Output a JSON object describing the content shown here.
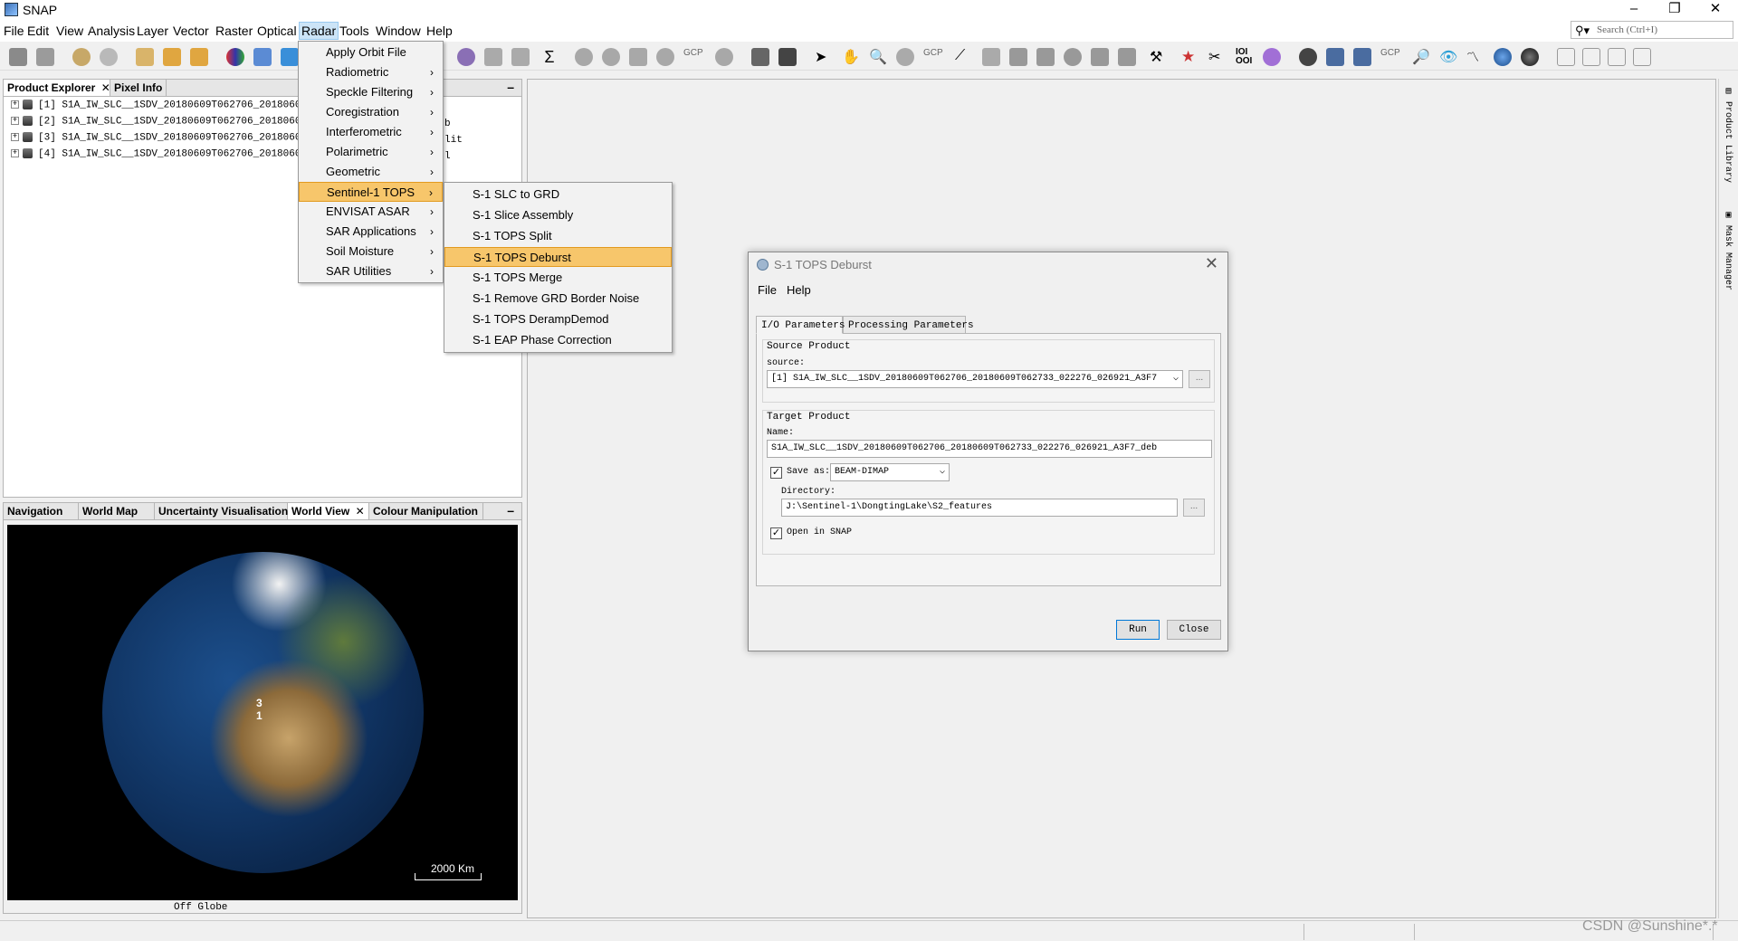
{
  "window": {
    "title": "SNAP",
    "controls": [
      "–",
      "❐",
      "✕"
    ]
  },
  "menubar": {
    "items": [
      "File",
      "Edit",
      "View",
      "Analysis",
      "Layer",
      "Vector",
      "Raster",
      "Optical",
      "Radar",
      "Tools",
      "Window",
      "Help"
    ],
    "search_placeholder": "Search (Ctrl+I)"
  },
  "toolbar": {
    "gcp_label": "GCP",
    "icon_names": [
      "open-product-icon",
      "save-product-icon",
      "undo-icon",
      "redo-icon",
      "import-icon",
      "export-icon",
      "band-maths-icon",
      "rgb-image-icon",
      "pin-icon",
      "polygon-icon",
      "graph-builder-icon",
      "batch-icon",
      "histogram-icon",
      "scatter-plot-icon",
      "statistics-icon",
      "mask-icon",
      "grid-icon",
      "gcp-icon",
      "select-icon",
      "pan-icon",
      "zoom-icon",
      "measure-icon",
      "world-map-icon",
      "3d-globe-icon",
      "layout-icons"
    ]
  },
  "radar_menu": {
    "items": [
      {
        "label": "Apply Orbit File",
        "submenu": false
      },
      {
        "label": "Radiometric",
        "submenu": true
      },
      {
        "label": "Speckle Filtering",
        "submenu": true
      },
      {
        "label": "Coregistration",
        "submenu": true
      },
      {
        "label": "Interferometric",
        "submenu": true
      },
      {
        "label": "Polarimetric",
        "submenu": true
      },
      {
        "label": "Geometric",
        "submenu": true
      },
      {
        "label": "Sentinel-1 TOPS",
        "submenu": true,
        "selected": true
      },
      {
        "label": "ENVISAT ASAR",
        "submenu": true
      },
      {
        "label": "SAR Applications",
        "submenu": true
      },
      {
        "label": "Soil Moisture",
        "submenu": true
      },
      {
        "label": "SAR Utilities",
        "submenu": true
      }
    ],
    "arrow": "›"
  },
  "tops_submenu": {
    "items": [
      {
        "label": "S-1 SLC to GRD"
      },
      {
        "label": "S-1 Slice Assembly"
      },
      {
        "label": "S-1 TOPS Split"
      },
      {
        "label": "S-1 TOPS Deburst",
        "selected": true
      },
      {
        "label": "S-1 TOPS Merge"
      },
      {
        "label": "S-1 Remove GRD Border Noise"
      },
      {
        "label": "S-1 TOPS DerampDemod"
      },
      {
        "label": "S-1 EAP Phase Correction"
      }
    ]
  },
  "product_explorer": {
    "tabs": [
      "Product Explorer",
      "Pixel Info"
    ],
    "close_glyph": "✕",
    "minimize_glyph": "–",
    "products": [
      {
        "text": "[1] S1A_IW_SLC__1SDV_20180609T062706_20180609T0",
        "suffix": ""
      },
      {
        "text": "[2] S1A_IW_SLC__1SDV_20180609T062706_20180609T0",
        "suffix": "b"
      },
      {
        "text": "[3] S1A_IW_SLC__1SDV_20180609T062706_20180609T0",
        "suffix": "lit"
      },
      {
        "text": "[4] S1A_IW_SLC__1SDV_20180609T062706_20180609T0",
        "suffix": "l"
      }
    ]
  },
  "bottom_panel": {
    "tabs": [
      "Navigation",
      "World Map",
      "Uncertainty Visualisation",
      "World View",
      "Colour Manipulation"
    ],
    "active_tab": "World View",
    "scale_label": "2000 Km",
    "marker_label": "3\n1",
    "status_text": "Off Globe"
  },
  "side_strip": {
    "tabs": [
      "Product Library",
      "Mask Manager"
    ]
  },
  "dialog": {
    "title": "S-1 TOPS Deburst",
    "menu": [
      "File",
      "Help"
    ],
    "close_glyph": "✕",
    "tabs": [
      "I/O Parameters",
      "Processing Parameters"
    ],
    "source_group": "Source Product",
    "source_label": "source:",
    "source_value": "[1] S1A_IW_SLC__1SDV_20180609T062706_20180609T062733_022276_026921_A3F7",
    "target_group": "Target Product",
    "name_label": "Name:",
    "name_value": "S1A_IW_SLC__1SDV_20180609T062706_20180609T062733_022276_026921_A3F7_deb",
    "save_as_label": "Save as:",
    "save_as_checked": true,
    "format_value": "BEAM-DIMAP",
    "directory_label": "Directory:",
    "directory_value": "J:\\Sentinel-1\\DongtingLake\\S2_features",
    "open_in_snap_label": "Open in SNAP",
    "open_in_snap_checked": true,
    "browse_label": "...",
    "run_label": "Run",
    "close_label": "Close"
  },
  "watermark": "CSDN @Sunshine*.*"
}
